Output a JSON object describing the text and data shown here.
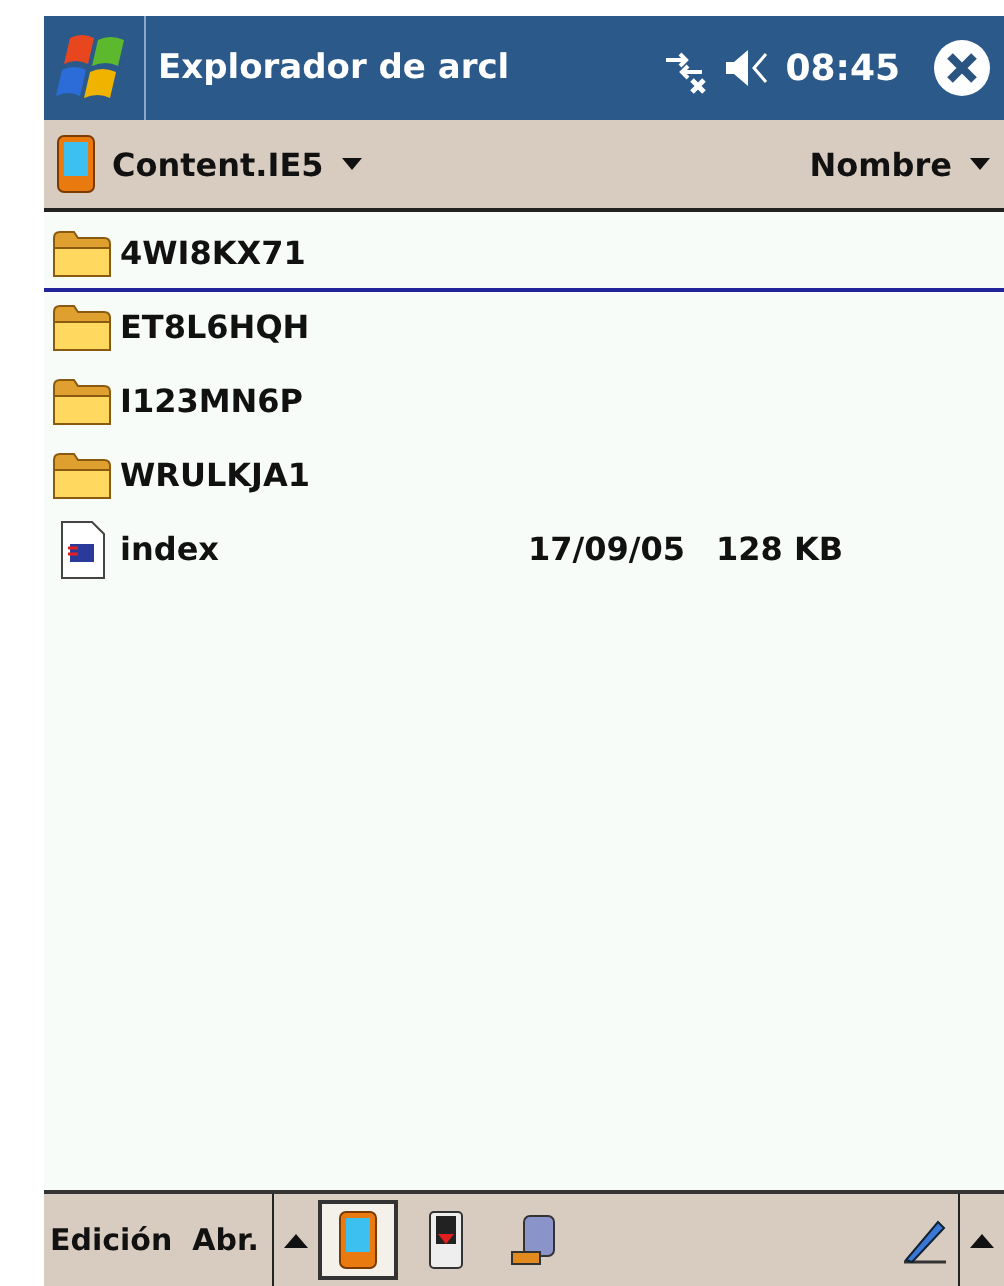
{
  "title_bar": {
    "title": "Explorador de arcl",
    "time": "08:45"
  },
  "location_bar": {
    "folder": "Content.IE5",
    "sort": "Nombre"
  },
  "files": [
    {
      "kind": "folder",
      "name": "4WI8KX71",
      "selected": true
    },
    {
      "kind": "folder",
      "name": "ET8L6HQH",
      "selected": false
    },
    {
      "kind": "folder",
      "name": "I123MN6P",
      "selected": false
    },
    {
      "kind": "folder",
      "name": "WRULKJA1",
      "selected": false
    },
    {
      "kind": "file",
      "name": "index",
      "date": "17/09/05",
      "size": "128 KB",
      "selected": false
    }
  ],
  "menu_bar": {
    "menus": [
      "Edición",
      "Abr."
    ],
    "locations": [
      {
        "kind": "device",
        "selected": true
      },
      {
        "kind": "card",
        "selected": false
      },
      {
        "kind": "network",
        "selected": false
      }
    ]
  }
}
